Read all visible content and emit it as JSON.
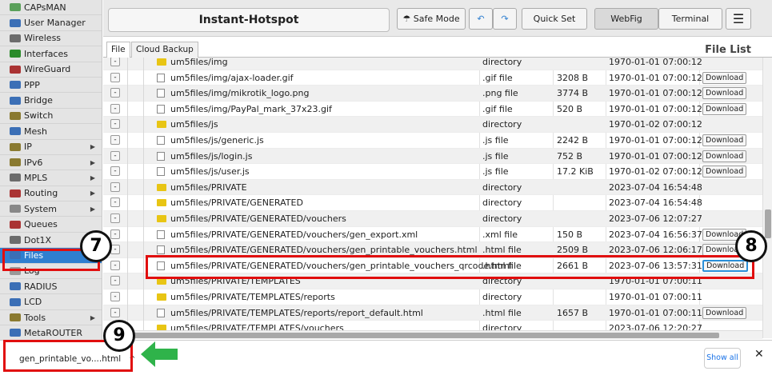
{
  "sidebar": {
    "items": [
      {
        "label": "CAPsMAN",
        "icon": "wifi-icon",
        "color": "#5aa05a",
        "arrow": false
      },
      {
        "label": "User Manager",
        "icon": "users-icon",
        "color": "#3b6fb6",
        "arrow": false
      },
      {
        "label": "Wireless",
        "icon": "wifi-icon",
        "color": "#6c6c6c",
        "arrow": false
      },
      {
        "label": "Interfaces",
        "icon": "interfaces-icon",
        "color": "#2b8b2b",
        "arrow": false
      },
      {
        "label": "WireGuard",
        "icon": "wireguard-icon",
        "color": "#a33",
        "arrow": false
      },
      {
        "label": "PPP",
        "icon": "ppp-icon",
        "color": "#3b6fb6",
        "arrow": false
      },
      {
        "label": "Bridge",
        "icon": "bridge-icon",
        "color": "#3b6fb6",
        "arrow": false
      },
      {
        "label": "Switch",
        "icon": "switch-icon",
        "color": "#8a7a30",
        "arrow": false
      },
      {
        "label": "Mesh",
        "icon": "mesh-icon",
        "color": "#3b6fb6",
        "arrow": false
      },
      {
        "label": "IP",
        "icon": "ip-icon",
        "color": "#8a7a30",
        "arrow": true
      },
      {
        "label": "IPv6",
        "icon": "ipv6-icon",
        "color": "#8a7a30",
        "arrow": true
      },
      {
        "label": "MPLS",
        "icon": "mpls-icon",
        "color": "#6c6c6c",
        "arrow": true
      },
      {
        "label": "Routing",
        "icon": "routing-icon",
        "color": "#a33",
        "arrow": true
      },
      {
        "label": "System",
        "icon": "system-icon",
        "color": "#888",
        "arrow": true
      },
      {
        "label": "Queues",
        "icon": "queues-icon",
        "color": "#a33",
        "arrow": false
      },
      {
        "label": "Dot1X",
        "icon": "dot1x-icon",
        "color": "#6c6c6c",
        "arrow": false
      },
      {
        "label": "Files",
        "icon": "files-icon",
        "color": "#3b6fb6",
        "arrow": false,
        "active": true
      },
      {
        "label": "Log",
        "icon": "log-icon",
        "color": "#999",
        "arrow": false
      },
      {
        "label": "RADIUS",
        "icon": "radius-icon",
        "color": "#3b6fb6",
        "arrow": false
      },
      {
        "label": "LCD",
        "icon": "lcd-icon",
        "color": "#3b6fb6",
        "arrow": false
      },
      {
        "label": "Tools",
        "icon": "tools-icon",
        "color": "#8a7a30",
        "arrow": true
      },
      {
        "label": "MetaROUTER",
        "icon": "metarouter-icon",
        "color": "#3b6fb6",
        "arrow": false
      }
    ]
  },
  "toolbar": {
    "device_title": "Instant-Hotspot",
    "safe_mode": "Safe Mode",
    "quick_set": "Quick Set",
    "webfig": "WebFig",
    "terminal": "Terminal"
  },
  "tabs": {
    "file": "File",
    "cloud_backup": "Cloud Backup"
  },
  "panel_title": "File List",
  "download_label": "Download",
  "files": [
    {
      "name": "um5files/img",
      "type": "directory",
      "size": "",
      "date": "1970-01-01 07:00:12",
      "kind": "folder",
      "download": false
    },
    {
      "name": "um5files/img/ajax-loader.gif",
      "type": ".gif file",
      "size": "3208 B",
      "date": "1970-01-01 07:00:12",
      "kind": "file",
      "download": true
    },
    {
      "name": "um5files/img/mikrotik_logo.png",
      "type": ".png file",
      "size": "3774 B",
      "date": "1970-01-01 07:00:12",
      "kind": "file",
      "download": true
    },
    {
      "name": "um5files/img/PayPal_mark_37x23.gif",
      "type": ".gif file",
      "size": "520 B",
      "date": "1970-01-01 07:00:12",
      "kind": "file",
      "download": true
    },
    {
      "name": "um5files/js",
      "type": "directory",
      "size": "",
      "date": "1970-01-02 07:00:12",
      "kind": "folder",
      "download": false
    },
    {
      "name": "um5files/js/generic.js",
      "type": ".js file",
      "size": "2242 B",
      "date": "1970-01-01 07:00:12",
      "kind": "file",
      "download": true
    },
    {
      "name": "um5files/js/login.js",
      "type": ".js file",
      "size": "752 B",
      "date": "1970-01-01 07:00:12",
      "kind": "file",
      "download": true
    },
    {
      "name": "um5files/js/user.js",
      "type": ".js file",
      "size": "17.2 KiB",
      "date": "1970-01-02 07:00:12",
      "kind": "file",
      "download": true
    },
    {
      "name": "um5files/PRIVATE",
      "type": "directory",
      "size": "",
      "date": "2023-07-04 16:54:48",
      "kind": "folder",
      "download": false
    },
    {
      "name": "um5files/PRIVATE/GENERATED",
      "type": "directory",
      "size": "",
      "date": "2023-07-04 16:54:48",
      "kind": "folder",
      "download": false
    },
    {
      "name": "um5files/PRIVATE/GENERATED/vouchers",
      "type": "directory",
      "size": "",
      "date": "2023-07-06 12:07:27",
      "kind": "folder",
      "download": false
    },
    {
      "name": "um5files/PRIVATE/GENERATED/vouchers/gen_export.xml",
      "type": ".xml file",
      "size": "150 B",
      "date": "2023-07-04 16:56:37",
      "kind": "file",
      "download": true
    },
    {
      "name": "um5files/PRIVATE/GENERATED/vouchers/gen_printable_vouchers.html",
      "type": ".html file",
      "size": "2509 B",
      "date": "2023-07-06 12:06:17",
      "kind": "file",
      "download": true
    },
    {
      "name": "um5files/PRIVATE/GENERATED/vouchers/gen_printable_vouchers_qrcode.html",
      "type": ".html file",
      "size": "2661 B",
      "date": "2023-07-06 13:57:31",
      "kind": "file",
      "download": true,
      "focus": true
    },
    {
      "name": "um5files/PRIVATE/TEMPLATES",
      "type": "directory",
      "size": "",
      "date": "1970-01-01 07:00:11",
      "kind": "folder",
      "download": false
    },
    {
      "name": "um5files/PRIVATE/TEMPLATES/reports",
      "type": "directory",
      "size": "",
      "date": "1970-01-01 07:00:11",
      "kind": "folder",
      "download": false
    },
    {
      "name": "um5files/PRIVATE/TEMPLATES/reports/report_default.html",
      "type": ".html file",
      "size": "1657 B",
      "date": "1970-01-01 07:00:11",
      "kind": "file",
      "download": true
    },
    {
      "name": "um5files/PRIVATE/TEMPLATES/vouchers",
      "type": "directory",
      "size": "",
      "date": "2023-07-06 12:20:27",
      "kind": "folder",
      "download": false
    }
  ],
  "download_bar": {
    "filename": "gen_printable_vo....html",
    "show_all": "Show all"
  },
  "annotations": {
    "step7": "7",
    "step8": "8",
    "step9": "9"
  },
  "colors": {
    "highlight_red": "#e10e0e",
    "active_blue": "#2f7fd0",
    "arrow_green": "#2fb34a"
  }
}
